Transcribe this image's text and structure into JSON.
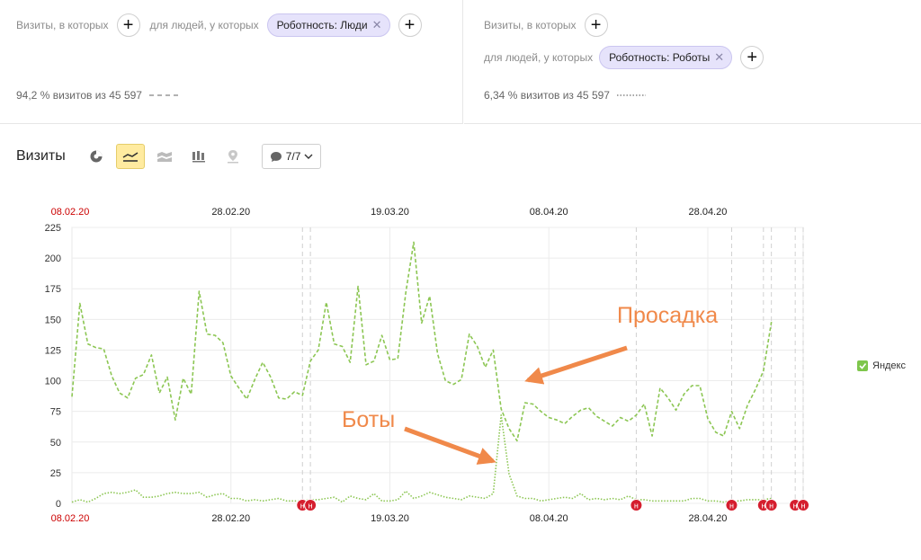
{
  "segment_left": {
    "visits_label": "Визиты, в которых",
    "people_label": "для людей, у которых",
    "chip_label": "Роботность: Люди",
    "stat": "94,2 % визитов из 45 597"
  },
  "segment_right": {
    "visits_label": "Визиты, в которых",
    "people_label": "для людей, у которых",
    "chip_label": "Роботность: Роботы",
    "stat": "6,34 % визитов из 45 597"
  },
  "toolbar": {
    "title": "Визиты",
    "dropdown_value": "7/7",
    "icons": [
      "pie-chart-icon",
      "line-chart-icon",
      "stacked-area-icon",
      "bar-chart-icon",
      "map-pin-icon",
      "comment-icon",
      "chevron-down-icon"
    ]
  },
  "chart_data": {
    "type": "line",
    "title": "",
    "xlabel": "",
    "ylabel": "",
    "ylim": [
      0,
      225
    ],
    "yticks": [
      "0",
      "25",
      "50",
      "75",
      "100",
      "125",
      "150",
      "175",
      "200",
      "225"
    ],
    "x_range": [
      "08.02.20",
      "10.05.20"
    ],
    "top_tick_labels": [
      "08.02.20",
      "28.02.20",
      "19.03.20",
      "08.04.20",
      "28.04.20"
    ],
    "bottom_tick_labels": [
      "08.02.20",
      "28.02.20",
      "19.03.20",
      "08.04.20",
      "28.04.20"
    ],
    "weekend_tick_label": "08.02.20",
    "weekend_color": "#cc0000",
    "grid": true,
    "legend_position": "right",
    "legend": "Яндекс",
    "series": [
      {
        "style": "dashed",
        "color": "#8cc653",
        "values": [
          87,
          163,
          130,
          127,
          126,
          104,
          90,
          86,
          102,
          105,
          121,
          90,
          103,
          68,
          102,
          89,
          173,
          138,
          137,
          131,
          104,
          94,
          85,
          101,
          115,
          103,
          86,
          85,
          91,
          88,
          116,
          125,
          164,
          130,
          128,
          115,
          177,
          113,
          116,
          137,
          117,
          118,
          172,
          213,
          147,
          169,
          122,
          100,
          97,
          101,
          138,
          128,
          111,
          125,
          77,
          61,
          51,
          82,
          81,
          75,
          70,
          68,
          65,
          71,
          76,
          78,
          71,
          67,
          63,
          70,
          67,
          72,
          81,
          55,
          94,
          86,
          76,
          89,
          96,
          96,
          69,
          58,
          55,
          75,
          61,
          80,
          93,
          108,
          148
        ]
      },
      {
        "style": "dotted",
        "color": "#8cc653",
        "values": [
          1,
          3,
          1,
          4,
          8,
          9,
          8,
          9,
          11,
          5,
          5,
          6,
          8,
          9,
          8,
          8,
          9,
          5,
          7,
          8,
          4,
          4,
          2,
          3,
          2,
          3,
          4,
          2,
          2,
          2,
          3,
          3,
          4,
          5,
          1,
          6,
          4,
          3,
          8,
          2,
          2,
          3,
          10,
          4,
          6,
          9,
          7,
          5,
          4,
          3,
          6,
          5,
          4,
          8,
          72,
          24,
          6,
          4,
          4,
          2,
          3,
          4,
          5,
          4,
          8,
          3,
          4,
          3,
          4,
          3,
          6,
          3,
          3,
          2,
          2,
          2,
          2,
          2,
          4,
          4,
          2,
          2,
          1,
          2,
          2,
          3,
          3,
          3,
          4
        ]
      }
    ],
    "holidays": [
      "08.03.20",
      "09.03.20",
      "19.04.20",
      "01.05.20",
      "05.05.20",
      "06.05.20",
      "09.05.20",
      "10.05.20"
    ],
    "holiday_marker_label": "н",
    "annotations": [
      {
        "text": "Просадка",
        "color": "#f0894a"
      },
      {
        "text": "Боты",
        "color": "#f0894a"
      }
    ]
  }
}
